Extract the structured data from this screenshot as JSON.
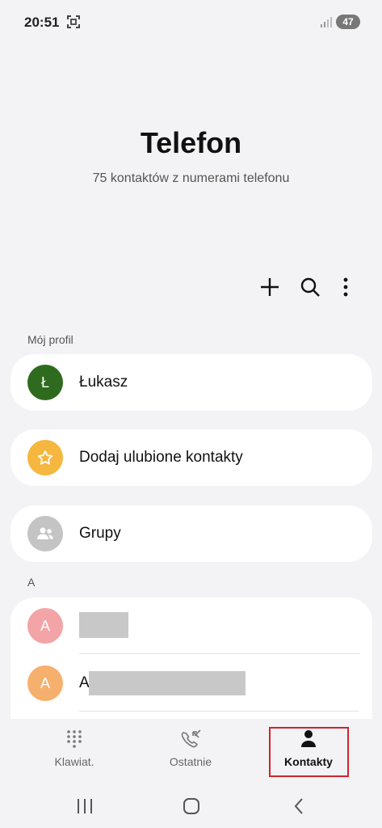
{
  "status": {
    "time": "20:51",
    "battery": "47"
  },
  "header": {
    "title": "Telefon",
    "subtitle": "75 kontaktów z numerami telefonu"
  },
  "toolbar": {
    "add_icon": "plus-icon",
    "search_icon": "search-icon",
    "more_icon": "more-vertical-icon"
  },
  "profile": {
    "section_label": "Mój profil",
    "initial": "Ł",
    "name": "Łukasz",
    "avatar_color": "#2e6b1f"
  },
  "favorites": {
    "label": "Dodaj ulubione kontakty",
    "icon": "star-icon",
    "avatar_color": "#f5b73f"
  },
  "groups": {
    "label": "Grupy",
    "icon": "groups-icon",
    "avatar_color": "#c4c4c4"
  },
  "contacts": {
    "section_label": "A",
    "items": [
      {
        "initial": "A",
        "name": "",
        "avatar_color": "#f2a4a6"
      },
      {
        "initial": "A",
        "name": "A",
        "avatar_color": "#f6b06e"
      }
    ]
  },
  "bottom_nav": {
    "tabs": [
      {
        "label": "Klawiat.",
        "icon": "keypad-icon",
        "active": false
      },
      {
        "label": "Ostatnie",
        "icon": "recent-calls-icon",
        "active": false
      },
      {
        "label": "Kontakty",
        "icon": "person-icon",
        "active": true
      }
    ],
    "highlight_color": "#d0242c"
  },
  "system_nav": {
    "recents_icon": "recents-icon",
    "home_icon": "home-icon",
    "back_icon": "back-icon"
  }
}
